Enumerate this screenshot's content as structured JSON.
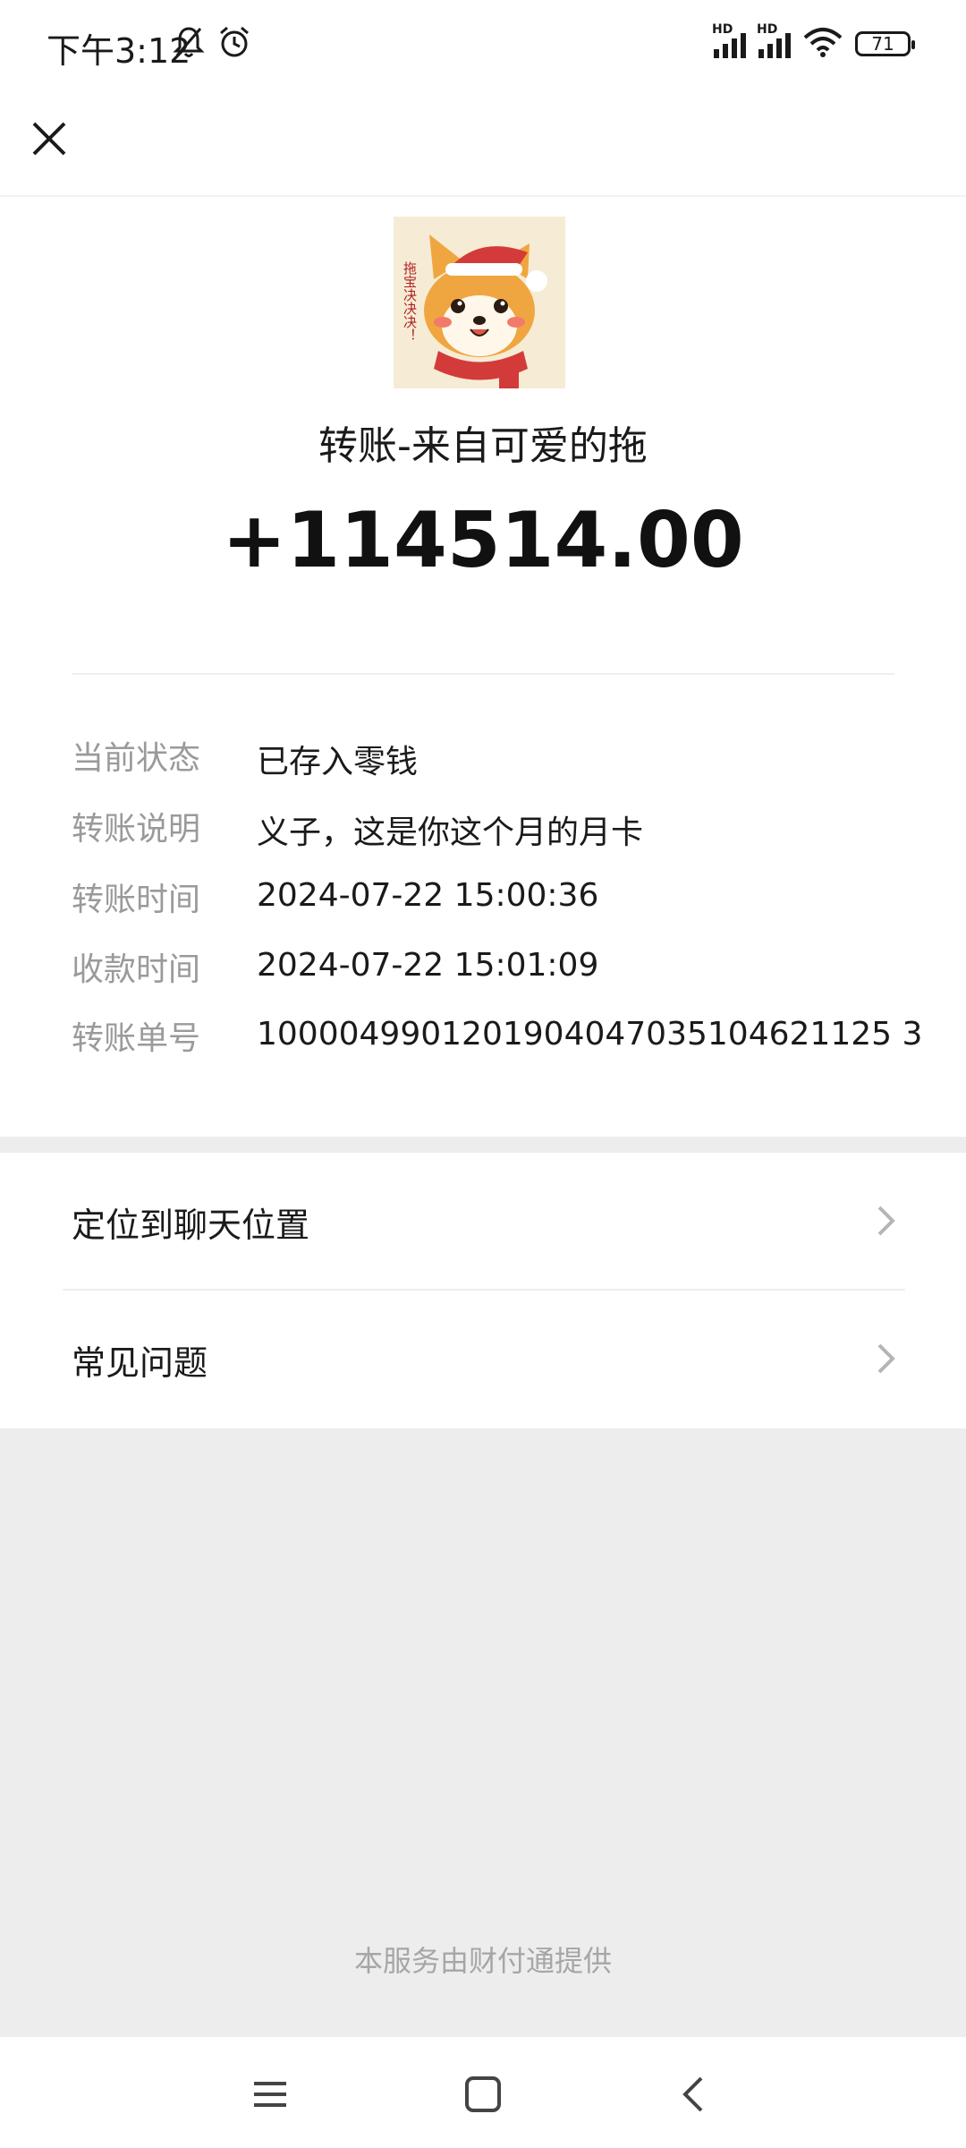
{
  "status_bar": {
    "time": "下午3:12",
    "battery": "71",
    "icons": [
      "mute-bell-icon",
      "alarm-clock-icon",
      "hd-signal-icon",
      "hd-signal-icon",
      "wifi-icon",
      "battery-icon"
    ],
    "hd_label": "HD"
  },
  "header": {
    "close_icon": "close-icon"
  },
  "transfer": {
    "title": "转账-来自可爱的拖",
    "amount": "+114514.00",
    "avatar_text": "拖宝决决决！",
    "details": [
      {
        "label": "当前状态",
        "value": "已存入零钱"
      },
      {
        "label": "转账说明",
        "value": "义子，这是你这个月的月卡"
      },
      {
        "label": "转账时间",
        "value": "2024-07-22 15:00:36"
      },
      {
        "label": "收款时间",
        "value": "2024-07-22 15:01:09"
      },
      {
        "label": "转账单号",
        "value": "1000049901201904047035104621125 3"
      }
    ]
  },
  "menu": [
    {
      "label": "定位到聊天位置"
    },
    {
      "label": "常见问题"
    }
  ],
  "footer": {
    "text": "本服务由财付通提供"
  },
  "nav": {
    "icons": [
      "menu-icon",
      "home-icon",
      "back-icon"
    ]
  },
  "colors": {
    "page_bg": "#ededed",
    "card_bg": "#ffffff",
    "label_gray": "#9a9a9a"
  }
}
